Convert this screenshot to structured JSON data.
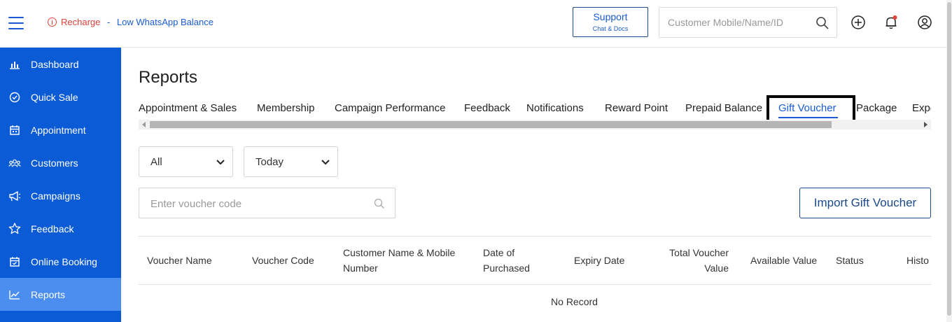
{
  "header": {
    "recharge_label": "Recharge",
    "recharge_separator": " - ",
    "recharge_message": "Low WhatsApp Balance",
    "support_title": "Support",
    "support_subtitle": "Chat & Docs",
    "search_placeholder": "Customer Mobile/Name/ID",
    "icons": [
      "menu-icon",
      "info-icon",
      "search-icon",
      "plus-circle-icon",
      "bell-icon",
      "user-icon"
    ]
  },
  "sidebar": {
    "items": [
      {
        "label": "Dashboard",
        "icon": "bar-chart-icon",
        "active": false
      },
      {
        "label": "Quick Sale",
        "icon": "check-circle-icon",
        "active": false
      },
      {
        "label": "Appointment",
        "icon": "calendar-icon",
        "active": false
      },
      {
        "label": "Customers",
        "icon": "users-icon",
        "active": false
      },
      {
        "label": "Campaigns",
        "icon": "megaphone-icon",
        "active": false
      },
      {
        "label": "Feedback",
        "icon": "star-icon",
        "active": false
      },
      {
        "label": "Online Booking",
        "icon": "calendar-check-icon",
        "active": false
      },
      {
        "label": "Reports",
        "icon": "line-chart-icon",
        "active": true
      }
    ]
  },
  "main": {
    "title": "Reports",
    "tabs": [
      {
        "label": "Appointment & Sales"
      },
      {
        "label": "Membership"
      },
      {
        "label": "Campaign Performance"
      },
      {
        "label": "Feedback"
      },
      {
        "label": "Notifications"
      },
      {
        "label": "Reward Point"
      },
      {
        "label": "Prepaid Balance"
      },
      {
        "label": "Gift Voucher",
        "active": true
      },
      {
        "label": "Package"
      },
      {
        "label": "Expe"
      }
    ],
    "filters": {
      "type_selected": "All",
      "period_selected": "Today"
    },
    "voucher_search_placeholder": "Enter voucher code",
    "import_button_label": "Import Gift Voucher",
    "table": {
      "columns": [
        [
          "Voucher Name"
        ],
        [
          "Voucher Code"
        ],
        [
          "Customer Name & Mobile",
          "Number"
        ],
        [
          "Date of",
          "Purchased"
        ],
        [
          "Expiry Date"
        ],
        [
          "Total Voucher",
          "Value"
        ],
        [
          "Available Value"
        ],
        [
          "Status"
        ],
        [
          "Histo"
        ]
      ],
      "empty_text": "No Record"
    }
  },
  "colors": {
    "sidebar_bg": "#0b5bd7",
    "sidebar_active": "#4b8ef0",
    "accent": "#1a5cd6",
    "alert": "#e0433a"
  }
}
